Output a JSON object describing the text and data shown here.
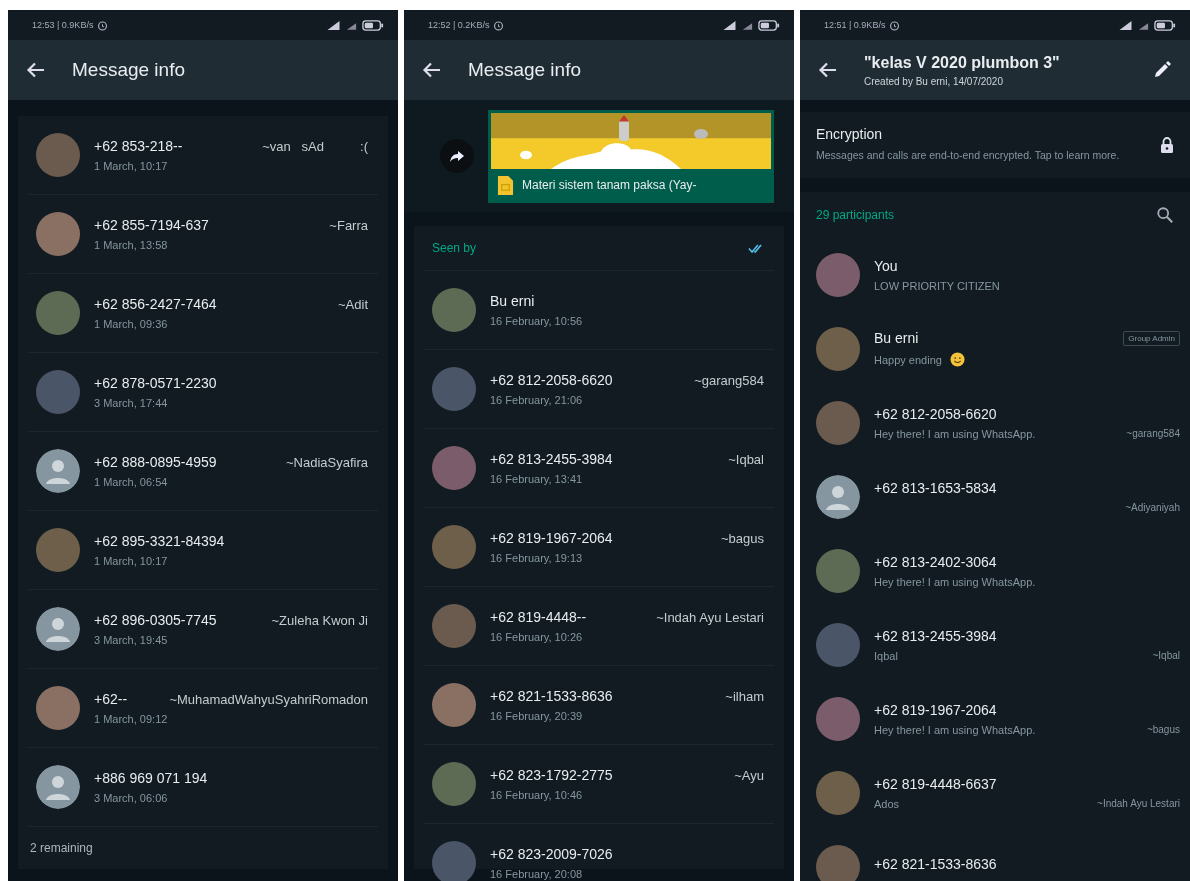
{
  "screens": [
    {
      "kind": "message_info_list",
      "status_bar": {
        "time": "12:53 | 0.9KB/s"
      },
      "header": {
        "title": "Message info"
      },
      "contacts": [
        {
          "kind": "photo",
          "name": "+62 853-218--",
          "push_name": "~van   sAd          :(",
          "time": "1 March, 10:17"
        },
        {
          "kind": "photo",
          "name": "+62 855-7194-637",
          "push_name": "~Farra",
          "time": "1 March, 13:58"
        },
        {
          "kind": "photo",
          "name": "+62 856-2427-7464",
          "push_name": "~Adit",
          "time": "1 March, 09:36"
        },
        {
          "kind": "photo",
          "name": "+62 878-0571-2230",
          "time": "3 March, 17:44"
        },
        {
          "kind": "default",
          "name": "+62 888-0895-4959",
          "push_name": "~NadiaSyafira",
          "time": "1 March, 06:54"
        },
        {
          "kind": "photo",
          "name": "+62 895-3321-84394",
          "time": "1 March, 10:17"
        },
        {
          "kind": "default",
          "name": "+62 896-0305-7745",
          "push_name": "~Zuleha Kwon Ji",
          "time": "3 March, 19:45"
        },
        {
          "kind": "photo",
          "name": "+62--",
          "push_name": "~MuhamadWahyuSyahriRomadon",
          "time": "1 March, 09:12"
        },
        {
          "kind": "default",
          "name": "+886 969 071 194",
          "time": "3 March, 06:06"
        }
      ],
      "footer": "2 remaining"
    },
    {
      "kind": "message_info_seen",
      "status_bar": {
        "time": "12:52 | 0.2KB/s"
      },
      "header": {
        "title": "Message info"
      },
      "message": {
        "caption": "Materi sistem tanam paksa (Yay-"
      },
      "section_title": "Seen by",
      "contacts": [
        {
          "kind": "photo",
          "name": "Bu erni",
          "time": "16 February, 10:56"
        },
        {
          "kind": "photo",
          "name": "+62 812-2058-6620",
          "push_name": "~garang584",
          "time": "16 February, 21:06"
        },
        {
          "kind": "photo",
          "name": "+62 813-2455-3984",
          "push_name": "~Iqbal",
          "time": "16 February, 13:41"
        },
        {
          "kind": "photo",
          "name": "+62 819-1967-2064",
          "push_name": "~bagus",
          "time": "16 February, 19:13"
        },
        {
          "kind": "photo",
          "name": "+62 819-4448--",
          "push_name": "~Indah Ayu Lestari",
          "time": "16 February, 10:26"
        },
        {
          "kind": "photo",
          "name": "+62 821-1533-8636",
          "push_name": "~ilham",
          "time": "16 February, 20:39"
        },
        {
          "kind": "photo",
          "name": "+62 823-1792-2775",
          "push_name": "~Ayu",
          "time": "16 February, 10:46"
        },
        {
          "kind": "photo",
          "name": "+62 823-2009-7026",
          "time": "16 February, 20:08"
        }
      ]
    },
    {
      "kind": "group_info",
      "status_bar": {
        "time": "12:51 | 0.9KB/s"
      },
      "header": {
        "title": "\"kelas V 2020 plumbon 3\"",
        "subtitle": "Created by Bu erni, 14/07/2020"
      },
      "encryption": {
        "title": "Encryption",
        "text": "Messages and calls are end-to-end encrypted. Tap to learn more."
      },
      "section_title": "29 participants",
      "contacts": [
        {
          "kind": "photo",
          "name": "You",
          "status": "LOW PRIORITY CITIZEN"
        },
        {
          "kind": "photo",
          "name": "Bu erni",
          "status": "Happy ending",
          "emoji_icon": true,
          "badge": "Group Admin"
        },
        {
          "kind": "photo",
          "name": "+62 812-2058-6620",
          "status": "Hey there! I am using WhatsApp.",
          "push_name": "~garang584"
        },
        {
          "kind": "default",
          "name": "+62 813-1653-5834",
          "push_name": "~Adiyaniyah"
        },
        {
          "kind": "photo",
          "name": "+62 813-2402-3064",
          "status": "Hey there! I am using WhatsApp."
        },
        {
          "kind": "photo",
          "name": "+62 813-2455-3984",
          "status": "Iqbal",
          "push_name": "~Iqbal"
        },
        {
          "kind": "photo",
          "name": "+62 819-1967-2064",
          "status": "Hey there! I am using WhatsApp.",
          "push_name": "~bagus"
        },
        {
          "kind": "photo",
          "name": "+62 819-4448-6637",
          "status": "Ados",
          "push_name": "~Indah Ayu Lestari"
        },
        {
          "kind": "photo",
          "name": "+62 821-1533-8636"
        }
      ]
    }
  ]
}
